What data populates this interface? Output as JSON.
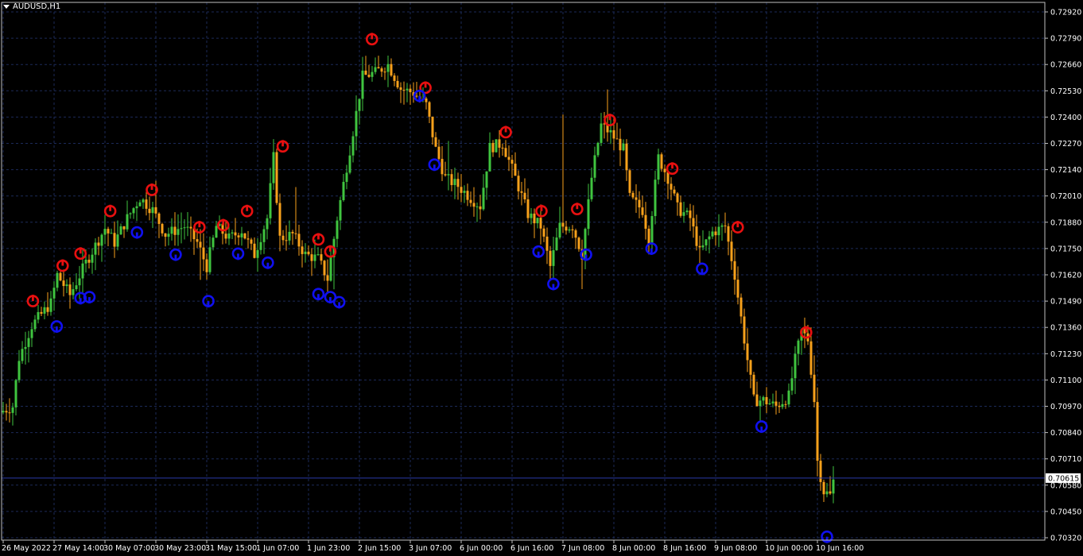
{
  "window": {
    "title": "AUDUSD,H1",
    "current_price_label": "0.70615"
  },
  "colors": {
    "background": "#000000",
    "grid": "#1c2a58",
    "axis": "#c0c0c0",
    "text": "#ffffff",
    "bull": "#3fc43f",
    "bear": "#f7a11b",
    "arrow_down": "#e81010",
    "arrow_up": "#1010ee",
    "price_line": "#2b3aa8"
  },
  "chart_data": {
    "type": "candlestick",
    "symbol": "AUDUSD",
    "timeframe": "H1",
    "ylim": [
      0.7032,
      0.7292
    ],
    "y_ticks": [
      "0.72920",
      "0.72790",
      "0.72660",
      "0.72530",
      "0.72400",
      "0.72270",
      "0.72140",
      "0.72010",
      "0.71880",
      "0.71750",
      "0.71620",
      "0.71490",
      "0.71360",
      "0.71230",
      "0.71100",
      "0.70970",
      "0.70840",
      "0.70710",
      "0.70580",
      "0.70450",
      "0.70320"
    ],
    "x_ticks": [
      {
        "label": "26 May 2022",
        "bar": 0
      },
      {
        "label": "27 May 14:00",
        "bar": 16
      },
      {
        "label": "30 May 07:00",
        "bar": 32
      },
      {
        "label": "30 May 23:00",
        "bar": 48
      },
      {
        "label": "31 May 15:00",
        "bar": 64
      },
      {
        "label": "1 Jun 07:00",
        "bar": 80
      },
      {
        "label": "1 Jun 23:00",
        "bar": 96
      },
      {
        "label": "2 Jun 15:00",
        "bar": 112
      },
      {
        "label": "3 Jun 07:00",
        "bar": 128
      },
      {
        "label": "6 Jun 00:00",
        "bar": 144
      },
      {
        "label": "6 Jun 16:00",
        "bar": 160
      },
      {
        "label": "7 Jun 08:00",
        "bar": 176
      },
      {
        "label": "8 Jun 00:00",
        "bar": 192
      },
      {
        "label": "8 Jun 16:00",
        "bar": 208
      },
      {
        "label": "9 Jun 08:00",
        "bar": 224
      },
      {
        "label": "10 Jun 00:00",
        "bar": 240
      },
      {
        "label": "10 Jun 16:00",
        "bar": 256
      }
    ],
    "bar_count": 262,
    "path_points": [
      [
        0,
        0.7094
      ],
      [
        4,
        0.7097
      ],
      [
        6,
        0.7121
      ],
      [
        10,
        0.7137
      ],
      [
        16,
        0.7148
      ],
      [
        18,
        0.7162
      ],
      [
        22,
        0.7152
      ],
      [
        27,
        0.7168
      ],
      [
        33,
        0.7185
      ],
      [
        36,
        0.7178
      ],
      [
        40,
        0.719
      ],
      [
        44,
        0.72
      ],
      [
        48,
        0.7194
      ],
      [
        52,
        0.7182
      ],
      [
        58,
        0.7186
      ],
      [
        62,
        0.7178
      ],
      [
        65,
        0.7166
      ],
      [
        68,
        0.7186
      ],
      [
        72,
        0.718
      ],
      [
        76,
        0.7184
      ],
      [
        80,
        0.7172
      ],
      [
        84,
        0.719
      ],
      [
        86,
        0.722
      ],
      [
        88,
        0.718
      ],
      [
        92,
        0.7182
      ],
      [
        96,
        0.7172
      ],
      [
        100,
        0.717
      ],
      [
        103,
        0.716
      ],
      [
        106,
        0.719
      ],
      [
        110,
        0.7224
      ],
      [
        114,
        0.726
      ],
      [
        118,
        0.7262
      ],
      [
        122,
        0.7266
      ],
      [
        126,
        0.7254
      ],
      [
        130,
        0.7252
      ],
      [
        134,
        0.7246
      ],
      [
        137,
        0.7224
      ],
      [
        140,
        0.721
      ],
      [
        144,
        0.7206
      ],
      [
        148,
        0.72
      ],
      [
        151,
        0.7196
      ],
      [
        154,
        0.7225
      ],
      [
        158,
        0.7227
      ],
      [
        162,
        0.721
      ],
      [
        166,
        0.7192
      ],
      [
        170,
        0.7186
      ],
      [
        173,
        0.7166
      ],
      [
        176,
        0.7186
      ],
      [
        180,
        0.7186
      ],
      [
        183,
        0.7172
      ],
      [
        186,
        0.721
      ],
      [
        189,
        0.7236
      ],
      [
        192,
        0.7232
      ],
      [
        196,
        0.7224
      ],
      [
        198,
        0.72
      ],
      [
        202,
        0.7194
      ],
      [
        204,
        0.718
      ],
      [
        207,
        0.722
      ],
      [
        210,
        0.721
      ],
      [
        213,
        0.7195
      ],
      [
        217,
        0.719
      ],
      [
        220,
        0.7173
      ],
      [
        224,
        0.7183
      ],
      [
        228,
        0.7186
      ],
      [
        231,
        0.7162
      ],
      [
        234,
        0.713
      ],
      [
        237,
        0.71
      ],
      [
        240,
        0.71
      ],
      [
        244,
        0.7097
      ],
      [
        248,
        0.7102
      ],
      [
        250,
        0.712
      ],
      [
        252,
        0.7134
      ],
      [
        254,
        0.713
      ],
      [
        256,
        0.71
      ],
      [
        257,
        0.707
      ],
      [
        259,
        0.7055
      ],
      [
        261,
        0.7053
      ],
      [
        262,
        0.706
      ]
    ],
    "current_price": 0.70615,
    "signals_down": [
      {
        "bar": 10,
        "price": 0.7149
      },
      {
        "bar": 20,
        "price": 0.71665
      },
      {
        "bar": 26,
        "price": 0.71725
      },
      {
        "bar": 36,
        "price": 0.71935
      },
      {
        "bar": 50,
        "price": 0.7204
      },
      {
        "bar": 66,
        "price": 0.71855
      },
      {
        "bar": 74,
        "price": 0.71865
      },
      {
        "bar": 82,
        "price": 0.71935
      },
      {
        "bar": 94,
        "price": 0.72255
      },
      {
        "bar": 106,
        "price": 0.71795
      },
      {
        "bar": 110,
        "price": 0.71735
      },
      {
        "bar": 124,
        "price": 0.72785
      },
      {
        "bar": 142,
        "price": 0.72545
      },
      {
        "bar": 169,
        "price": 0.72325
      },
      {
        "bar": 181,
        "price": 0.71935
      },
      {
        "bar": 193,
        "price": 0.71945
      },
      {
        "bar": 204,
        "price": 0.72385
      },
      {
        "bar": 225,
        "price": 0.72145
      },
      {
        "bar": 247,
        "price": 0.71855
      },
      {
        "bar": 270,
        "price": 0.71335
      }
    ],
    "signals_up": [
      {
        "bar": 18,
        "price": 0.71365
      },
      {
        "bar": 26,
        "price": 0.71505
      },
      {
        "bar": 29,
        "price": 0.7151
      },
      {
        "bar": 45,
        "price": 0.7183
      },
      {
        "bar": 58,
        "price": 0.7172
      },
      {
        "bar": 69,
        "price": 0.7149
      },
      {
        "bar": 79,
        "price": 0.71725
      },
      {
        "bar": 89,
        "price": 0.7168
      },
      {
        "bar": 106,
        "price": 0.71525
      },
      {
        "bar": 110,
        "price": 0.7151
      },
      {
        "bar": 113,
        "price": 0.71485
      },
      {
        "bar": 140,
        "price": 0.72505
      },
      {
        "bar": 145,
        "price": 0.72165
      },
      {
        "bar": 180,
        "price": 0.71735
      },
      {
        "bar": 185,
        "price": 0.71575
      },
      {
        "bar": 196,
        "price": 0.7172
      },
      {
        "bar": 218,
        "price": 0.7175
      },
      {
        "bar": 235,
        "price": 0.7165
      },
      {
        "bar": 255,
        "price": 0.7087
      },
      {
        "bar": 277,
        "price": 0.70325
      }
    ]
  }
}
